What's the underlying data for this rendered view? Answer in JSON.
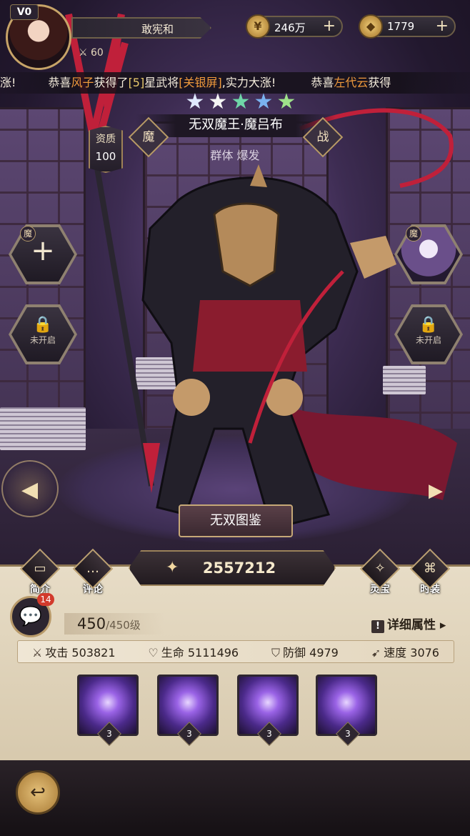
{
  "player": {
    "vip": "V0",
    "name": "敢宪和",
    "power_partial": "60"
  },
  "currencies": [
    {
      "icon": "coin-icon",
      "value": "246万"
    },
    {
      "icon": "ingot-icon",
      "value": "1779"
    }
  ],
  "ticker": {
    "pre": "涨!",
    "msg1_a": "恭喜",
    "msg1_name": "风子",
    "msg1_b": "获得了",
    "msg1_star": "[5]",
    "msg1_c": "星武将",
    "msg1_hero": "[关银屏]",
    "msg1_d": ",实力大涨!",
    "msg2_a": "恭喜",
    "msg2_name": "左代云",
    "msg2_b": "获得"
  },
  "hero": {
    "stars": 5,
    "title": "无双魔王·魔吕布",
    "faction": "魔",
    "role": "战",
    "type": "群体 爆发",
    "quality_label": "资质",
    "quality_value": "100",
    "codex_label": "无双图鉴"
  },
  "slots": {
    "left_badge": "魔",
    "right_badge": "魔",
    "locked_label_left": "未开启",
    "locked_label_right": "未开启"
  },
  "power": "2557212",
  "menu": {
    "intro": "简介",
    "comment": "评论",
    "treasure": "灵宝",
    "fashion": "时装"
  },
  "chat_badge": "14",
  "level": {
    "current": "450",
    "max": "/450级"
  },
  "detail_label": "详细属性",
  "stats": {
    "attack": "攻击 503821",
    "hp": "生命 5111496",
    "defense": "防御 4979",
    "speed": "速度 3076"
  },
  "skills": [
    {
      "level": "3"
    },
    {
      "level": "3"
    },
    {
      "level": "3"
    },
    {
      "level": "3"
    }
  ],
  "colors": {
    "accent_gold": "#c7a468",
    "highlight_orange": "#f09a3c",
    "ticker_yellow": "#e6c76b",
    "panel_bg": "#e7dcc6"
  }
}
